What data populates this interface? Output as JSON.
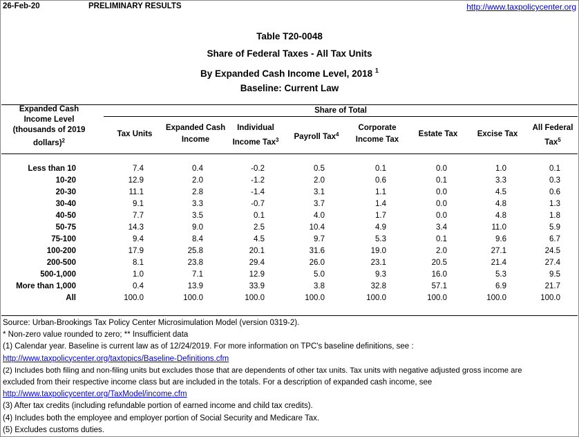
{
  "header": {
    "date": "26-Feb-20",
    "status": "PRELIMINARY RESULTS",
    "url": "http://www.taxpolicycenter.org"
  },
  "titles": {
    "table_id": "Table T20-0048",
    "subject": "Share of Federal Taxes - All Tax Units",
    "level": "By Expanded Cash Income Level, 2018",
    "level_note": "1",
    "baseline": "Baseline: Current Law"
  },
  "table": {
    "income_header": [
      "Expanded Cash",
      "Income Level",
      "(thousands of 2019",
      "dollars)"
    ],
    "income_header_note": "2",
    "share_title": "Share of Total",
    "columns": [
      {
        "lines": [
          "Tax Units"
        ],
        "note": ""
      },
      {
        "lines": [
          "Expanded Cash",
          "Income"
        ],
        "note": ""
      },
      {
        "lines": [
          "Individual",
          "Income Tax"
        ],
        "note": "3"
      },
      {
        "lines": [
          "Payroll Tax"
        ],
        "note": "4"
      },
      {
        "lines": [
          "Corporate",
          "Income Tax"
        ],
        "note": ""
      },
      {
        "lines": [
          "Estate Tax"
        ],
        "note": ""
      },
      {
        "lines": [
          "Excise Tax"
        ],
        "note": ""
      },
      {
        "lines": [
          "All Federal",
          "Tax"
        ],
        "note": "5"
      }
    ],
    "rows": [
      {
        "label": "Less than 10",
        "values": [
          "7.4",
          "0.4",
          "-0.2",
          "0.5",
          "0.1",
          "0.0",
          "1.0",
          "0.1"
        ]
      },
      {
        "label": "10-20",
        "values": [
          "12.9",
          "2.0",
          "-1.2",
          "2.0",
          "0.6",
          "0.1",
          "3.3",
          "0.3"
        ]
      },
      {
        "label": "20-30",
        "values": [
          "11.1",
          "2.8",
          "-1.4",
          "3.1",
          "1.1",
          "0.0",
          "4.5",
          "0.6"
        ]
      },
      {
        "label": "30-40",
        "values": [
          "9.1",
          "3.3",
          "-0.7",
          "3.7",
          "1.4",
          "0.0",
          "4.8",
          "1.3"
        ]
      },
      {
        "label": "40-50",
        "values": [
          "7.7",
          "3.5",
          "0.1",
          "4.0",
          "1.7",
          "0.0",
          "4.8",
          "1.8"
        ]
      },
      {
        "label": "50-75",
        "values": [
          "14.3",
          "9.0",
          "2.5",
          "10.4",
          "4.9",
          "3.4",
          "11.0",
          "5.9"
        ]
      },
      {
        "label": "75-100",
        "values": [
          "9.4",
          "8.4",
          "4.5",
          "9.7",
          "5.3",
          "0.1",
          "9.6",
          "6.7"
        ]
      },
      {
        "label": "100-200",
        "values": [
          "17.9",
          "25.8",
          "20.1",
          "31.6",
          "19.0",
          "2.0",
          "27.1",
          "24.5"
        ]
      },
      {
        "label": "200-500",
        "values": [
          "8.1",
          "23.8",
          "29.4",
          "26.0",
          "23.1",
          "20.5",
          "21.4",
          "27.4"
        ]
      },
      {
        "label": "500-1,000",
        "values": [
          "1.0",
          "7.1",
          "12.9",
          "5.0",
          "9.3",
          "16.0",
          "5.3",
          "9.5"
        ]
      },
      {
        "label": "More than 1,000",
        "values": [
          "0.4",
          "13.9",
          "33.9",
          "3.8",
          "32.8",
          "57.1",
          "6.9",
          "21.7"
        ]
      },
      {
        "label": "All",
        "values": [
          "100.0",
          "100.0",
          "100.0",
          "100.0",
          "100.0",
          "100.0",
          "100.0",
          "100.0"
        ]
      }
    ]
  },
  "footnotes": {
    "source": "Source: Urban-Brookings Tax Policy Center Microsimulation Model (version 0319-2).",
    "star": "* Non-zero value rounded to zero; ** Insufficient data",
    "n1": "(1) Calendar year. Baseline is current law as of 12/24/2019. For more information on TPC's baseline definitions, see :",
    "n1_link": "http://www.taxpolicycenter.org/taxtopics/Baseline-Definitions.cfm",
    "n2a": "(2) Includes both filing and non-filing units but excludes those that are dependents of other tax units. Tax units with negative adjusted gross income are",
    "n2b": "excluded from their respective income class but are included in the totals. For a description of expanded cash income, see",
    "n2_link": "http://www.taxpolicycenter.org/TaxModel/income.cfm",
    "n3": "(3) After tax credits (including refundable portion of earned income and child tax credits).",
    "n4": "(4) Includes both the employee and employer portion of Social Security and Medicare Tax.",
    "n5": "(5) Excludes customs duties."
  }
}
